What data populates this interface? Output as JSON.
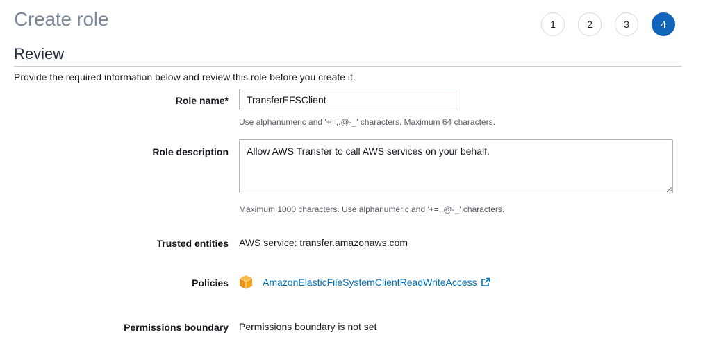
{
  "page": {
    "title": "Create role"
  },
  "steps": [
    "1",
    "2",
    "3",
    "4"
  ],
  "active_step": "4",
  "review": {
    "heading": "Review",
    "intro": "Provide the required information below and review this role before you create it."
  },
  "role_name": {
    "label": "Role name*",
    "value": "TransferEFSClient",
    "hint": "Use alphanumeric and '+=,.@-_' characters. Maximum 64 characters."
  },
  "role_description": {
    "label": "Role description",
    "value": "Allow AWS Transfer to call AWS services on your behalf.",
    "hint": "Maximum 1000 characters. Use alphanumeric and '+=,.@-_' characters."
  },
  "trusted_entities": {
    "label": "Trusted entities",
    "value": "AWS service: transfer.amazonaws.com"
  },
  "policies": {
    "label": "Policies",
    "items": [
      {
        "name": "AmazonElasticFileSystemClientReadWriteAccess",
        "icon": "policy-box-icon",
        "link_icon": "external-link-icon"
      }
    ]
  },
  "permissions_boundary": {
    "label": "Permissions boundary",
    "value": "Permissions boundary is not set"
  },
  "colors": {
    "accent": "#1166bb",
    "link": "#0073bb",
    "policy_icon": "#f2a31b"
  }
}
